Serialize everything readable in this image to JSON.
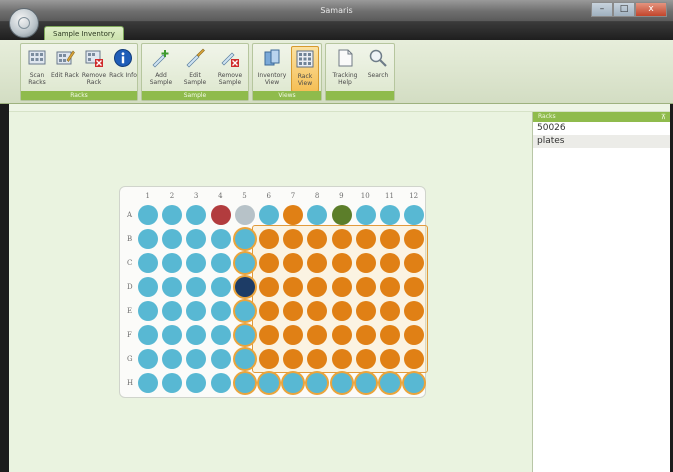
{
  "window": {
    "title": "Samaris"
  },
  "window_buttons": [
    "–",
    "□",
    "x"
  ],
  "tab": {
    "label": "Sample Inventory"
  },
  "ribbon": {
    "groups": [
      {
        "label": "Racks",
        "buttons": [
          {
            "label": "Scan Racks",
            "icon": "scan-racks-icon"
          },
          {
            "label": "Edit Rack",
            "icon": "edit-rack-icon"
          },
          {
            "label": "Remove Rack",
            "icon": "remove-rack-icon"
          },
          {
            "label": "Rack Info",
            "icon": "info-icon"
          }
        ]
      },
      {
        "label": "Sample",
        "buttons": [
          {
            "label": "Add Sample",
            "icon": "add-sample-icon"
          },
          {
            "label": "Edit Sample",
            "icon": "edit-sample-icon"
          },
          {
            "label": "Remove Sample",
            "icon": "remove-sample-icon"
          }
        ]
      },
      {
        "label": "Views",
        "buttons": [
          {
            "label": "Inventory View",
            "icon": "inventory-view-icon"
          },
          {
            "label": "Rack View",
            "icon": "rack-view-icon",
            "active": true
          }
        ]
      },
      {
        "label": "",
        "buttons": [
          {
            "label": "Tracking Help",
            "icon": "tracking-help-icon"
          },
          {
            "label": "Search",
            "icon": "search-icon"
          }
        ]
      }
    ]
  },
  "plate": {
    "columns": [
      "1",
      "2",
      "3",
      "4",
      "5",
      "6",
      "7",
      "8",
      "9",
      "10",
      "11",
      "12"
    ],
    "rows": [
      "A",
      "B",
      "C",
      "D",
      "E",
      "F",
      "G",
      "H"
    ],
    "wells": [
      [
        "blue",
        "blue",
        "blue",
        "red",
        "grey",
        "blue",
        "orange",
        "blue",
        "olive",
        "blue",
        "blue",
        "blue"
      ],
      [
        "blue",
        "blue",
        "blue",
        "blue",
        "blue",
        "orange",
        "orange",
        "orange",
        "orange",
        "orange",
        "orange",
        "orange"
      ],
      [
        "blue",
        "blue",
        "blue",
        "blue",
        "blue",
        "orange",
        "orange",
        "orange",
        "orange",
        "orange",
        "orange",
        "orange"
      ],
      [
        "blue",
        "blue",
        "blue",
        "blue",
        "navy",
        "orange",
        "orange",
        "orange",
        "orange",
        "orange",
        "orange",
        "orange"
      ],
      [
        "blue",
        "blue",
        "blue",
        "blue",
        "blue",
        "orange",
        "orange",
        "orange",
        "orange",
        "orange",
        "orange",
        "orange"
      ],
      [
        "blue",
        "blue",
        "blue",
        "blue",
        "blue",
        "orange",
        "orange",
        "orange",
        "orange",
        "orange",
        "orange",
        "orange"
      ],
      [
        "blue",
        "blue",
        "blue",
        "blue",
        "blue",
        "orange",
        "orange",
        "orange",
        "orange",
        "orange",
        "orange",
        "orange"
      ],
      [
        "blue",
        "blue",
        "blue",
        "blue",
        "blue",
        "blue",
        "blue",
        "blue",
        "blue",
        "blue",
        "blue",
        "blue"
      ]
    ],
    "colors": {
      "blue": "#58b8d3",
      "orange": "#e08015",
      "red": "#b23c3e",
      "grey": "#b7c2c8",
      "olive": "#5c7e2a",
      "navy": "#1d3c66"
    }
  },
  "racks_panel": {
    "title": "Racks",
    "pin": "⊼",
    "items": [
      "50026",
      "plates"
    ]
  }
}
